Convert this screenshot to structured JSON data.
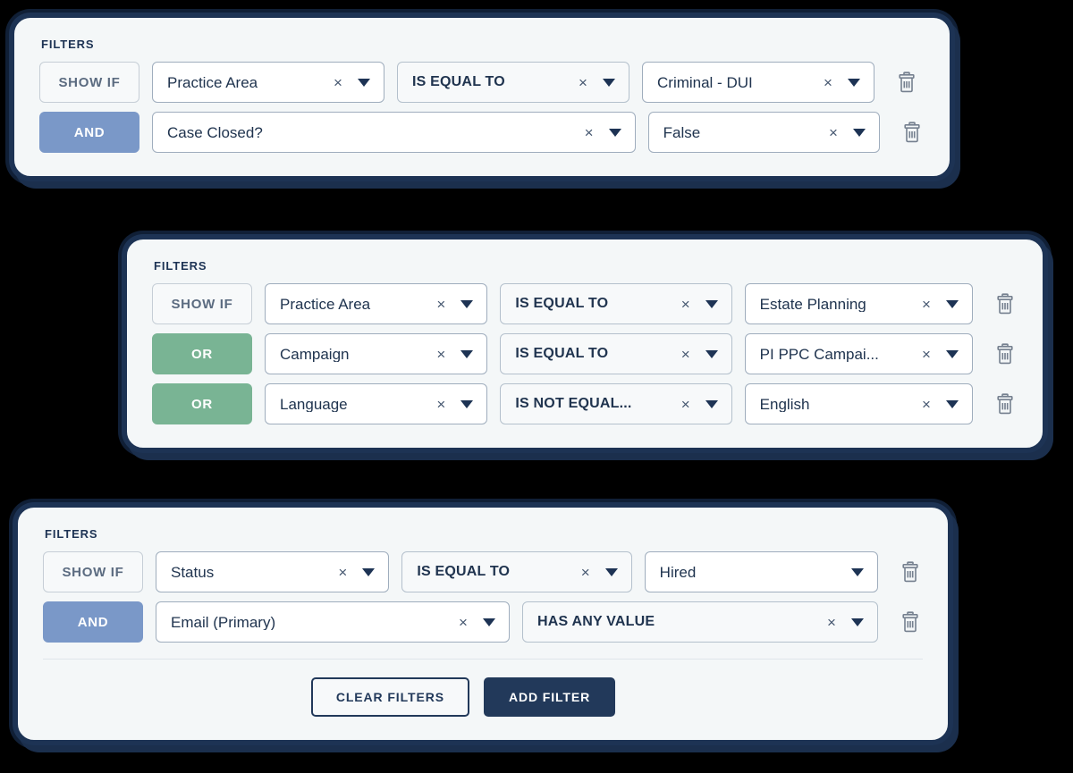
{
  "section_label": "FILTERS",
  "colors": {
    "page_background": "#000000",
    "card_background": "#f4f7f8",
    "card_border": "#1d3354",
    "and_pill": "#7a98c8",
    "or_pill": "#79b494",
    "showif_pill_text": "#5b6b80",
    "primary_button": "#22395a",
    "text": "#20344f"
  },
  "icons": {
    "clear": "×",
    "caret": "caret-down-icon",
    "delete": "trash-icon"
  },
  "cards": [
    {
      "id": "practice-area",
      "label": "FILTERS",
      "rows": [
        {
          "logic": "SHOW IF",
          "logic_kind": "showif",
          "property": "Practice Area",
          "operator": "IS EQUAL TO",
          "value": "Criminal - DUI",
          "property_clearable": true,
          "operator_clearable": true,
          "value_clearable": true
        },
        {
          "logic": "AND",
          "logic_kind": "and",
          "property": "Case Closed?",
          "operator": null,
          "value": "False",
          "property_clearable": true,
          "operator_clearable": false,
          "value_clearable": true
        }
      ]
    },
    {
      "id": "campaign",
      "label": "FILTERS",
      "rows": [
        {
          "logic": "SHOW IF",
          "logic_kind": "showif",
          "property": "Practice Area",
          "operator": "IS EQUAL TO",
          "value": "Estate Planning",
          "property_clearable": true,
          "operator_clearable": true,
          "value_clearable": true
        },
        {
          "logic": "OR",
          "logic_kind": "or",
          "property": "Campaign",
          "operator": "IS EQUAL TO",
          "value": "PI PPC Campai...",
          "property_clearable": true,
          "operator_clearable": true,
          "value_clearable": true
        },
        {
          "logic": "OR",
          "logic_kind": "or",
          "property": "Language",
          "operator": "IS NOT EQUAL...",
          "value": "English",
          "property_clearable": true,
          "operator_clearable": true,
          "value_clearable": true
        }
      ]
    },
    {
      "id": "status",
      "label": "FILTERS",
      "rows": [
        {
          "logic": "SHOW IF",
          "logic_kind": "showif",
          "property": "Status",
          "operator": "IS EQUAL TO",
          "value": "Hired",
          "property_clearable": true,
          "operator_clearable": true,
          "value_clearable": false
        },
        {
          "logic": "AND",
          "logic_kind": "and",
          "property": "Email (Primary)",
          "operator": "HAS ANY VALUE",
          "value": null,
          "property_clearable": true,
          "operator_clearable": true,
          "value_clearable": false
        }
      ],
      "actions": {
        "clear_label": "CLEAR FILTERS",
        "add_label": "ADD FILTER"
      }
    }
  ]
}
